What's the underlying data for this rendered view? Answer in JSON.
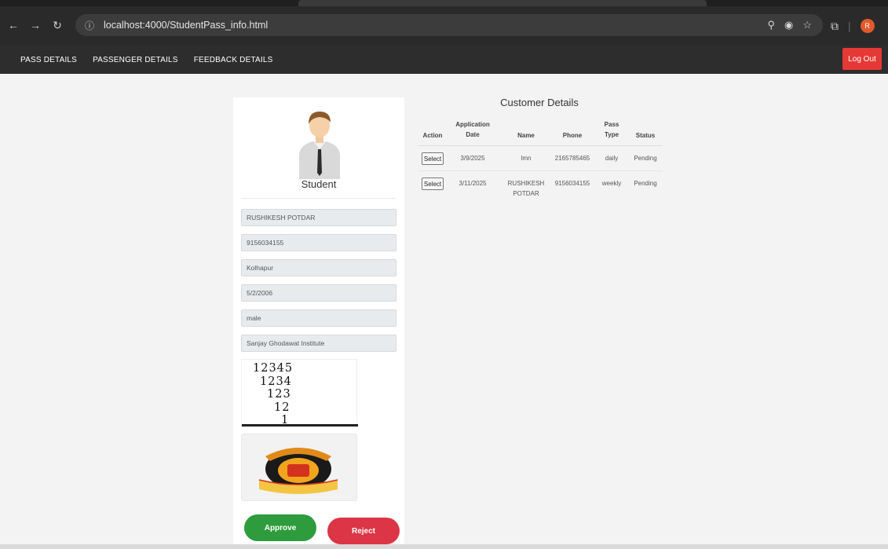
{
  "browser": {
    "url": "localhost:4000/StudentPass_info.html",
    "avatar_letter": "R"
  },
  "nav": {
    "links": [
      "PASS DETAILS",
      "PASSENGER DETAILS",
      "FEEDBACK DETAILS"
    ],
    "logout": "Log Out"
  },
  "student": {
    "label": "Student",
    "fields": [
      "RUSHIKESH POTDAR",
      "9156034155",
      "Kolhapur",
      "5/2/2006",
      "male",
      "Sanjay Ghodawat Institute"
    ],
    "pass_numbers": [
      "12345",
      "1234",
      "123",
      "12",
      "1"
    ],
    "logo_text": {
      "top": "महामंडळ सेवेचे",
      "center": "एस टी",
      "bottom": "महाराष्ट्र राज्य परिवहन"
    }
  },
  "actions": {
    "approve": "Approve",
    "reject": "Reject"
  },
  "customers": {
    "title": "Customer Details",
    "headers": {
      "action": "Action",
      "date": [
        "Application",
        "Date"
      ],
      "name": "Name",
      "phone": "Phone",
      "type": [
        "Pass",
        "Type"
      ],
      "status": "Status"
    },
    "rows": [
      {
        "action": "Select",
        "date": "3/9/2025",
        "name": [
          "lmn"
        ],
        "phone": "2165785465",
        "type": "daily",
        "status": "Pending"
      },
      {
        "action": "Select",
        "date": "3/11/2025",
        "name": [
          "RUSHIKESH",
          "POTDAR"
        ],
        "phone": "9156034155",
        "type": "weekly",
        "status": "Pending"
      }
    ]
  }
}
